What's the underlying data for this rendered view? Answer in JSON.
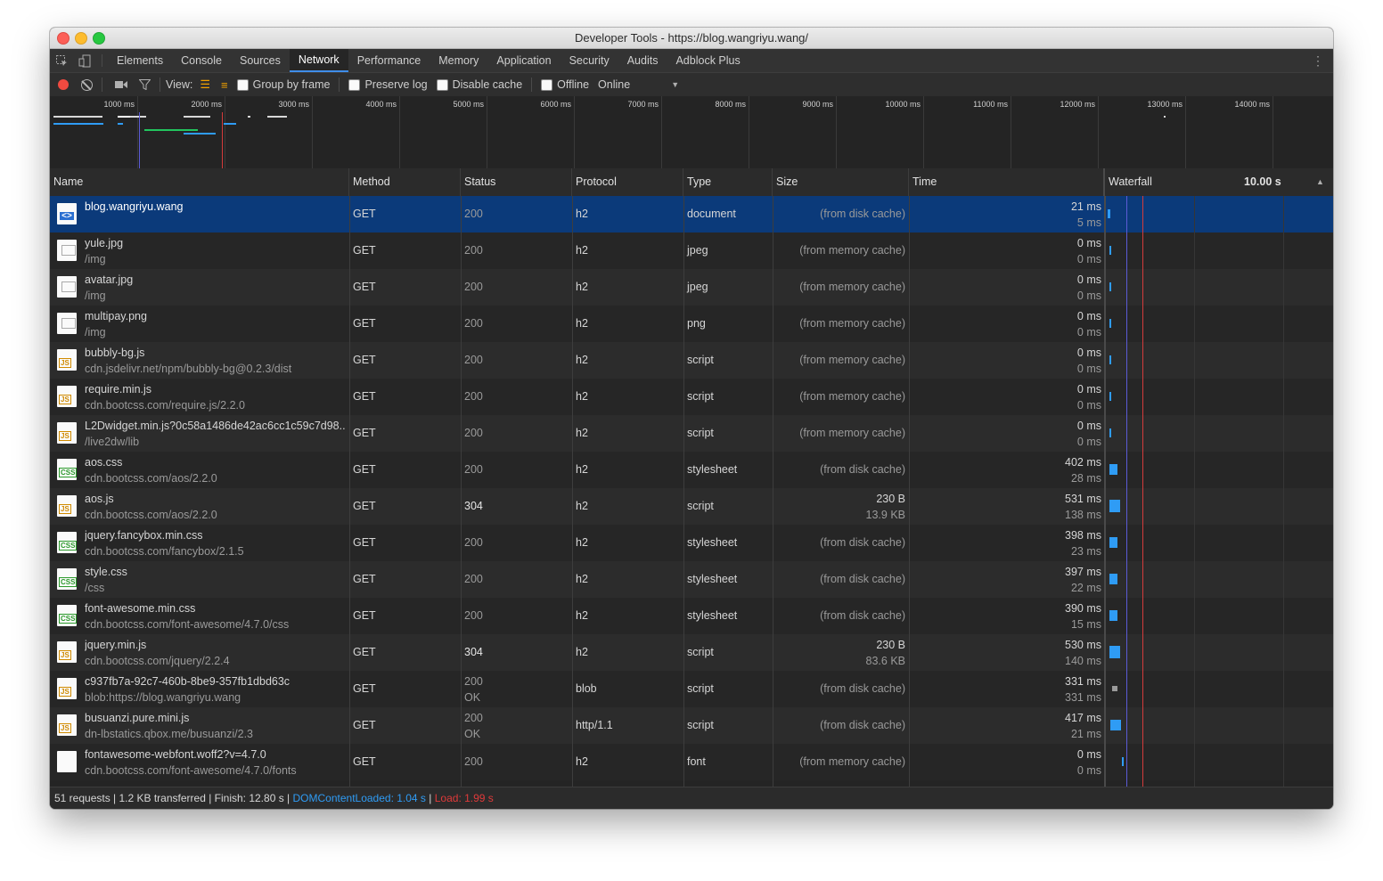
{
  "window": {
    "title": "Developer Tools - https://blog.wangriyu.wang/"
  },
  "tabs": [
    "Elements",
    "Console",
    "Sources",
    "Network",
    "Performance",
    "Memory",
    "Application",
    "Security",
    "Audits",
    "Adblock Plus"
  ],
  "active_tab": "Network",
  "toolbar": {
    "view_label": "View:",
    "group_by_frame": "Group by frame",
    "preserve_log": "Preserve log",
    "disable_cache": "Disable cache",
    "offline": "Offline",
    "throttle_value": "Online"
  },
  "overview_ticks": [
    "1000 ms",
    "2000 ms",
    "3000 ms",
    "4000 ms",
    "5000 ms",
    "6000 ms",
    "7000 ms",
    "8000 ms",
    "9000 ms",
    "10000 ms",
    "11000 ms",
    "12000 ms",
    "13000 ms",
    "14000 ms",
    "15"
  ],
  "columns": {
    "name": "Name",
    "method": "Method",
    "status": "Status",
    "protocol": "Protocol",
    "type": "Type",
    "size": "Size",
    "time": "Time",
    "waterfall": "Waterfall",
    "waterfall_time": "10.00 s"
  },
  "requests": [
    {
      "name": "blog.wangriyu.wang",
      "path": "",
      "icon": "doc",
      "method": "GET",
      "status": "200",
      "status_text": "",
      "protocol": "h2",
      "type": "document",
      "size": "(from disk cache)",
      "size2": "",
      "time": "21 ms",
      "latency": "5 ms"
    },
    {
      "name": "yule.jpg",
      "path": "/img",
      "icon": "img",
      "method": "GET",
      "status": "200",
      "status_text": "",
      "protocol": "h2",
      "type": "jpeg",
      "size": "(from memory cache)",
      "size2": "",
      "time": "0 ms",
      "latency": "0 ms"
    },
    {
      "name": "avatar.jpg",
      "path": "/img",
      "icon": "img",
      "method": "GET",
      "status": "200",
      "status_text": "",
      "protocol": "h2",
      "type": "jpeg",
      "size": "(from memory cache)",
      "size2": "",
      "time": "0 ms",
      "latency": "0 ms"
    },
    {
      "name": "multipay.png",
      "path": "/img",
      "icon": "img",
      "method": "GET",
      "status": "200",
      "status_text": "",
      "protocol": "h2",
      "type": "png",
      "size": "(from memory cache)",
      "size2": "",
      "time": "0 ms",
      "latency": "0 ms"
    },
    {
      "name": "bubbly-bg.js",
      "path": "cdn.jsdelivr.net/npm/bubbly-bg@0.2.3/dist",
      "icon": "js",
      "method": "GET",
      "status": "200",
      "status_text": "",
      "protocol": "h2",
      "type": "script",
      "size": "(from memory cache)",
      "size2": "",
      "time": "0 ms",
      "latency": "0 ms"
    },
    {
      "name": "require.min.js",
      "path": "cdn.bootcss.com/require.js/2.2.0",
      "icon": "js",
      "method": "GET",
      "status": "200",
      "status_text": "",
      "protocol": "h2",
      "type": "script",
      "size": "(from memory cache)",
      "size2": "",
      "time": "0 ms",
      "latency": "0 ms"
    },
    {
      "name": "L2Dwidget.min.js?0c58a1486de42ac6cc1c59c7d98...",
      "path": "/live2dw/lib",
      "icon": "js",
      "method": "GET",
      "status": "200",
      "status_text": "",
      "protocol": "h2",
      "type": "script",
      "size": "(from memory cache)",
      "size2": "",
      "time": "0 ms",
      "latency": "0 ms"
    },
    {
      "name": "aos.css",
      "path": "cdn.bootcss.com/aos/2.2.0",
      "icon": "css",
      "method": "GET",
      "status": "200",
      "status_text": "",
      "protocol": "h2",
      "type": "stylesheet",
      "size": "(from disk cache)",
      "size2": "",
      "time": "402 ms",
      "latency": "28 ms"
    },
    {
      "name": "aos.js",
      "path": "cdn.bootcss.com/aos/2.2.0",
      "icon": "js",
      "method": "GET",
      "status": "304",
      "status_text": "",
      "protocol": "h2",
      "type": "script",
      "size": "230 B",
      "size2": "13.9 KB",
      "time": "531 ms",
      "latency": "138 ms"
    },
    {
      "name": "jquery.fancybox.min.css",
      "path": "cdn.bootcss.com/fancybox/2.1.5",
      "icon": "css",
      "method": "GET",
      "status": "200",
      "status_text": "",
      "protocol": "h2",
      "type": "stylesheet",
      "size": "(from disk cache)",
      "size2": "",
      "time": "398 ms",
      "latency": "23 ms"
    },
    {
      "name": "style.css",
      "path": "/css",
      "icon": "css",
      "method": "GET",
      "status": "200",
      "status_text": "",
      "protocol": "h2",
      "type": "stylesheet",
      "size": "(from disk cache)",
      "size2": "",
      "time": "397 ms",
      "latency": "22 ms"
    },
    {
      "name": "font-awesome.min.css",
      "path": "cdn.bootcss.com/font-awesome/4.7.0/css",
      "icon": "css",
      "method": "GET",
      "status": "200",
      "status_text": "",
      "protocol": "h2",
      "type": "stylesheet",
      "size": "(from disk cache)",
      "size2": "",
      "time": "390 ms",
      "latency": "15 ms"
    },
    {
      "name": "jquery.min.js",
      "path": "cdn.bootcss.com/jquery/2.2.4",
      "icon": "js",
      "method": "GET",
      "status": "304",
      "status_text": "",
      "protocol": "h2",
      "type": "script",
      "size": "230 B",
      "size2": "83.6 KB",
      "time": "530 ms",
      "latency": "140 ms"
    },
    {
      "name": "c937fb7a-92c7-460b-8be9-357fb1dbd63c",
      "path": "blob:https://blog.wangriyu.wang",
      "icon": "js",
      "method": "GET",
      "status": "200",
      "status_text": "OK",
      "protocol": "blob",
      "type": "script",
      "size": "(from disk cache)",
      "size2": "",
      "time": "331 ms",
      "latency": "331 ms"
    },
    {
      "name": "busuanzi.pure.mini.js",
      "path": "dn-lbstatics.qbox.me/busuanzi/2.3",
      "icon": "js",
      "method": "GET",
      "status": "200",
      "status_text": "OK",
      "protocol": "http/1.1",
      "type": "script",
      "size": "(from disk cache)",
      "size2": "",
      "time": "417 ms",
      "latency": "21 ms"
    },
    {
      "name": "fontawesome-webfont.woff2?v=4.7.0",
      "path": "cdn.bootcss.com/font-awesome/4.7.0/fonts",
      "icon": "blank",
      "method": "GET",
      "status": "200",
      "status_text": "",
      "protocol": "h2",
      "type": "font",
      "size": "(from memory cache)",
      "size2": "",
      "time": "0 ms",
      "latency": "0 ms"
    }
  ],
  "status_bar": {
    "summary": "51 requests | 1.2 KB transferred | Finish: 12.80 s |",
    "dom_content_loaded": "DOMContentLoaded: 1.04 s",
    "separator": "|",
    "load": "Load: 1.99 s"
  },
  "colors": {
    "accent": "#3f8dea",
    "dom_line": "#5b5bd6",
    "load_line": "#d43b3b",
    "selected_row": "#0b3a7a"
  }
}
